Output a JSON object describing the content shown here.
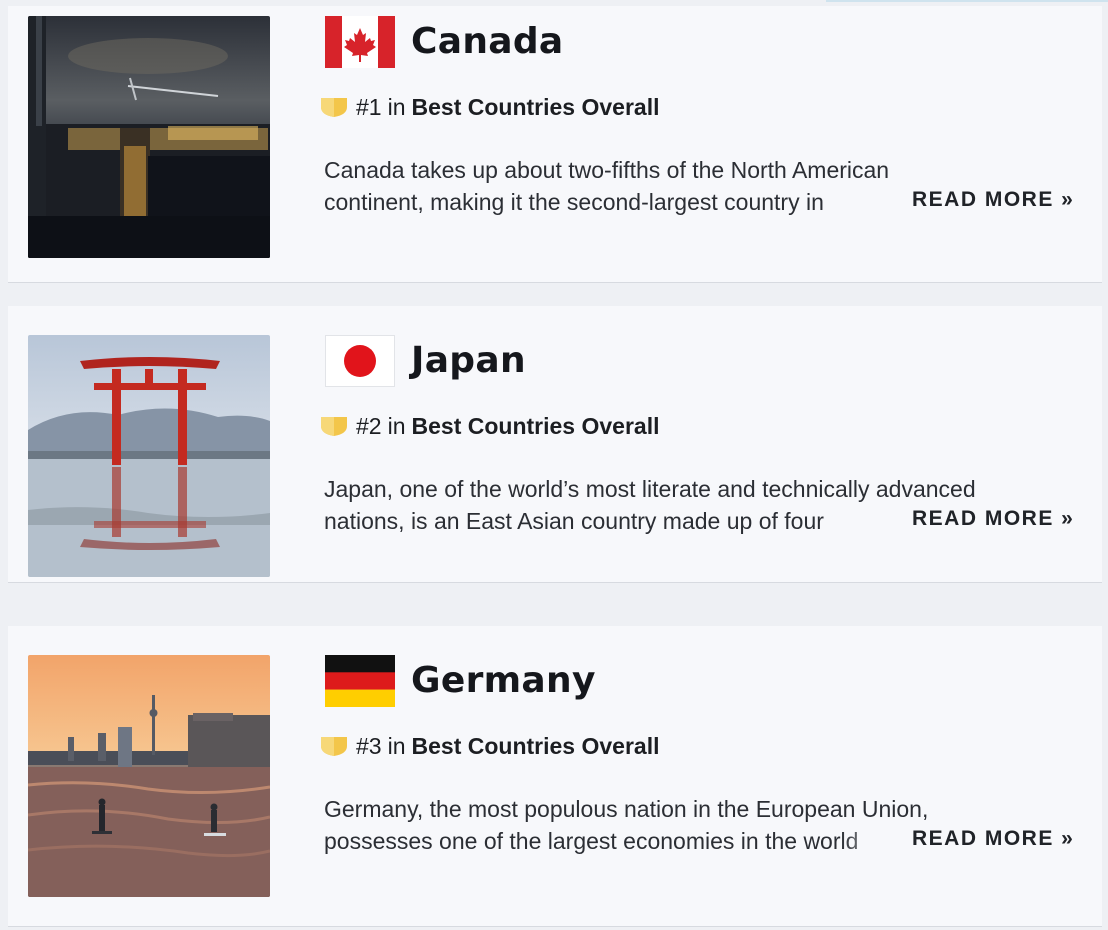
{
  "countries": [
    {
      "name": "Canada",
      "rank": "#1",
      "rank_connector": "in",
      "rank_list": "Best Countries Overall",
      "description_line1": "Canada takes up about two-fifths of the North American",
      "description_line2": "continent, making it the second-largest country in",
      "read_more": "READ MORE »",
      "flag_icon": "canada-flag-icon",
      "photo": "city-skyline-at-dusk"
    },
    {
      "name": "Japan",
      "rank": "#2",
      "rank_connector": "in",
      "rank_list": "Best Countries Overall",
      "description_line1": "Japan, one of the world’s most literate and technically advanced",
      "description_line2": "nations, is an East Asian country made up of four",
      "read_more": "READ MORE »",
      "flag_icon": "japan-flag-icon",
      "photo": "torii-gate-on-water"
    },
    {
      "name": "Germany",
      "rank": "#3",
      "rank_connector": "in",
      "rank_list": "Best Countries Overall",
      "description_line1": "Germany, the most populous nation in the European Union,",
      "description_line2": "possesses one of the largest economies in the world",
      "read_more": "READ MORE »",
      "flag_icon": "germany-flag-icon",
      "photo": "city-river-at-sunset"
    }
  ],
  "colors": {
    "badge_gold": "#f3c64a",
    "canada_red": "#d7232a",
    "japan_red": "#e1141b",
    "germany_black": "#111111",
    "germany_red": "#dd1b1b",
    "germany_gold": "#ffce00"
  }
}
